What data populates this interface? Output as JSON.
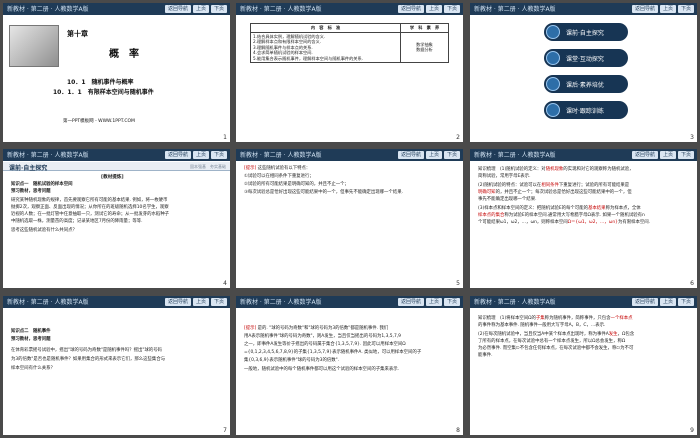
{
  "header": {
    "brand": "新教材 · 第二册 · 人教数学A版",
    "nav_label": "返回导航",
    "prev_label": "上页",
    "next_label": "下页"
  },
  "slide1": {
    "chapter": "第十章",
    "title": "概　率",
    "section1": "10．1　随机事件与概率",
    "section2": "10．1．1　有限样本空间与随机事件",
    "footer": "第一PPT模板网 - WWW.1PPT.COM",
    "num": "1"
  },
  "slide2": {
    "col_content": "内　容　标　准",
    "col_literacy": "学　科　素　养",
    "items": [
      "1.结合具体实例，理解随机试验的含义.",
      "2.理解样本点和有限样本空间的含义.",
      "3.理解随机事件与样本点的关系.",
      "4.会求简单随机试验的样本空间.",
      "5.能用集合表示随机事件，理解样本空间与随机事件的关系."
    ],
    "literacy": [
      "数学抽象",
      "数据分析"
    ],
    "num": "2"
  },
  "slide3": {
    "menu": [
      "课前·自主探究",
      "课堂·互动探究",
      "课后·素养培优",
      "课时·跟踪训练"
    ],
    "num": "3"
  },
  "slide4": {
    "title": "课前·自主探究",
    "tag": "固本强基　夯实基础",
    "label": "[教材提炼]",
    "lines": [
      "知识点一　随机试验的样本空间",
      "预习教材，思考问题",
      "研究某种随机现象的规律，首先要观察它所有可能的基本结果. 例如，将一枚硬币",
      "抛掷2次，观察正面、反面出现的情况；从你所在的班级随机选择10名学生，观察",
      "近视的人数；在一批灯管中任意抽取一只，测试它的寿命；从一批发芽的水稻种子",
      "中随机选取一株，测量苗的高度；记录某地区7月份的降雨量；等等.",
      "思考这些随机试验有什么共同点？"
    ],
    "num": "4"
  },
  "slide5": {
    "label": "[提示]",
    "lines": [
      "这些随机试验有以下特点：",
      "①试验可以在相同条件下重复进行；",
      "②试验的所有可能结果是明确可知的，并且不止一个；",
      "③每次试验总是恰好出现这些可能结果中的一个，但事先不能确定出现哪一个结果."
    ],
    "num": "5"
  },
  "slide6": {
    "lines": [
      "知识梳理　(1)随机试验的定义：对",
      "的实现和对它的观察称为随机试验，",
      "简称试验，常用字母E表示.",
      "(2)随机试验的特点：试验可以在",
      "下重复进行；试验的所有可能结果是",
      "的，并且不止一个；每次试验总是恰好出现这些可能结果中的一个，但",
      "事先不能确定出现哪一个结果.",
      "(3)样本点和样本空间的定义：把随机试验E的每个可能的",
      "称为样本点，全体",
      "称为试验E的样本空间.通常用大写希腊字母Ω表示. 如果一个随机试验有n",
      "个可能结果ω1，ω2，…，ωn，则称样本空间",
      "为有限样本空间."
    ],
    "fills": [
      "随机现象",
      "相同条件",
      "明确可知",
      "基本结果",
      "样本点的集合",
      "Ω＝{ω1，ω2，…，ωn}"
    ],
    "num": "6"
  },
  "slide7": {
    "lines": [
      "知识点二　随机事件",
      "预习教材，思考问题",
      "在体育彩票摇号试验中，摇出\"球的号码为奇数\"是随机事件吗？摇出\"球的号码",
      "为3的倍数\"是否也是随机事件？如果用集合的形式来表示它们，那么这些集合与",
      "样本空间有什么关系？"
    ],
    "num": "7"
  },
  "slide8": {
    "label": "[提示]",
    "lines": [
      "是的. \"球的号码为奇数\"和\"球的号码为3的倍数\"都是随机事件. 我们",
      "用A表示随机事件\"球的号码为奇数\"，则A发生，当且仅当摇出的号码为1,3,5,7,9",
      "之一，即事件A发生等价于摇出的号码属于集合{1,3,5,7,9}. 因此可以用样本空间Ω",
      "={0,1,2,3,4,5,6,7,8,9}的子集{1,3,5,7,9}表示随机事件A. 类似地，可以用样本空间的子",
      "集{0,3,6,9}表示随机事件\"球的号码为3的倍数\".",
      "一般地，随机试验中的每个随机事件都可以用这个试验的样本空间的子集来表示."
    ],
    "num": "8"
  },
  "slide9": {
    "lines": [
      "知识梳理　(1)将样本空间Ω的",
      "称为随机事件，简称事件，只包含",
      "的事件称为基本事件. 随机事件一般用大写字母A，B，C，…表示.",
      "(2)在每次随机试验中，当且仅当A中某个样本点出现时，称为事件A",
      "，Ω包含",
      "了所有的样本点，在每次试验中总有一个样本点发生，所以Ω总会发生，称Ω",
      "为必然事件. 而空集∅不包含任何样本点，在每次试验中都不会发生，称∅为不可",
      "能事件."
    ],
    "fills": [
      "子集",
      "一个样本点",
      "发生"
    ],
    "num": "9"
  }
}
